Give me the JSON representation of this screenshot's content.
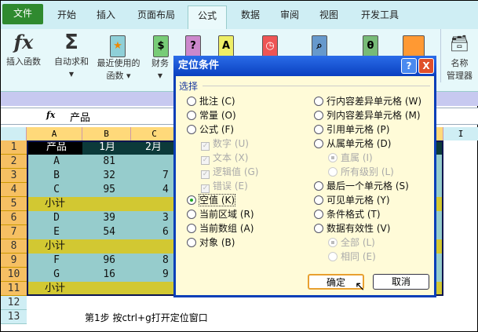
{
  "tabs": [
    "文件",
    "开始",
    "插入",
    "页面布局",
    "公式",
    "数据",
    "审阅",
    "视图",
    "开发工具"
  ],
  "ribbon": {
    "insert_function": "插入函数",
    "autosum": "自动求和",
    "recent_line1": "最近使用的",
    "recent_line2": "函数",
    "financial": "财务",
    "name_manager_line1": "名称",
    "name_manager_line2": "管理器"
  },
  "formula_bar": {
    "fx": "fx",
    "value": "产品"
  },
  "columns": [
    "A",
    "B",
    "C",
    "I"
  ],
  "rows": [
    "1",
    "2",
    "3",
    "4",
    "5",
    "6",
    "7",
    "8",
    "9",
    "10",
    "11",
    "12",
    "13"
  ],
  "table": {
    "header": [
      "产品",
      "1月",
      "2月"
    ],
    "data": [
      [
        "A",
        "81",
        ""
      ],
      [
        "B",
        "32",
        "7"
      ],
      [
        "C",
        "95",
        "4"
      ],
      [
        "小计",
        "",
        ""
      ],
      [
        "D",
        "39",
        "3"
      ],
      [
        "E",
        "54",
        "6"
      ],
      [
        "小计",
        "",
        ""
      ],
      [
        "F",
        "96",
        "8"
      ],
      [
        "G",
        "16",
        "9"
      ],
      [
        "小计",
        "",
        ""
      ]
    ]
  },
  "note": "第1步 按ctrl+g打开定位窗口",
  "dialog": {
    "title": "定位条件",
    "help": "?",
    "close": "X",
    "group": "选择",
    "left": [
      {
        "label": "批注 (C)",
        "state": "off"
      },
      {
        "label": "常量 (O)",
        "state": "off"
      },
      {
        "label": "公式 (F)",
        "state": "off"
      },
      {
        "label": "数字 (U)",
        "state": "chk"
      },
      {
        "label": "文本 (X)",
        "state": "chk"
      },
      {
        "label": "逻辑值 (G)",
        "state": "chk"
      },
      {
        "label": "错误 (E)",
        "state": "chk"
      },
      {
        "label": "空值 (K)",
        "state": "on"
      },
      {
        "label": "当前区域 (R)",
        "state": "off"
      },
      {
        "label": "当前数组 (A)",
        "state": "off"
      },
      {
        "label": "对象 (B)",
        "state": "off"
      }
    ],
    "right": [
      {
        "label": "行内容差异单元格 (W)",
        "state": "off"
      },
      {
        "label": "列内容差异单元格 (M)",
        "state": "off"
      },
      {
        "label": "引用单元格 (P)",
        "state": "off"
      },
      {
        "label": "从属单元格 (D)",
        "state": "off"
      },
      {
        "label": "直属 (I)",
        "state": "dison"
      },
      {
        "label": "所有级别 (L)",
        "state": "dis"
      },
      {
        "label": "最后一个单元格 (S)",
        "state": "off"
      },
      {
        "label": "可见单元格 (Y)",
        "state": "off"
      },
      {
        "label": "条件格式 (T)",
        "state": "off"
      },
      {
        "label": "数据有效性 (V)",
        "state": "off"
      },
      {
        "label": "全部 (L)",
        "state": "dison"
      },
      {
        "label": "相同 (E)",
        "state": "dis"
      }
    ],
    "ok": "确定",
    "cancel": "取消"
  }
}
